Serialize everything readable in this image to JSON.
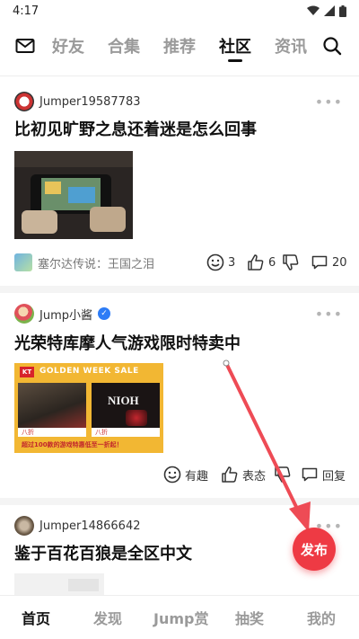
{
  "status_bar": {
    "time": "4:17"
  },
  "top_nav": {
    "tabs": [
      {
        "label": "好友"
      },
      {
        "label": "合集"
      },
      {
        "label": "推荐"
      },
      {
        "label": "社区",
        "active": true
      },
      {
        "label": "资讯"
      }
    ]
  },
  "posts": [
    {
      "author": "Jumper19587783",
      "title": "比初见旷野之息还着迷是怎么回事",
      "tag": "塞尔达传说：王国之泪",
      "stats": {
        "fun": "3",
        "likes": "6",
        "comments": "20"
      }
    },
    {
      "author": "Jump小酱",
      "title": "光荣特库摩人气游戏限时特卖中",
      "banner": {
        "logo": "KT",
        "heading": "GOLDEN WEEK SALE",
        "game_right": "NIOH",
        "footer": "超过100款的游戏特惠低至一折起！",
        "discount_left": "八折",
        "discount_right": "八折"
      },
      "actions": {
        "fun": "有趣",
        "attitude": "表态",
        "reply": "回复"
      }
    },
    {
      "author": "Jumper14866642",
      "title": "鉴于百花百狼是全区中文"
    }
  ],
  "fab": {
    "label": "发布"
  },
  "bottom_nav": {
    "items": [
      {
        "label": "首页",
        "active": true
      },
      {
        "label": "发现"
      },
      {
        "label": "Jump赏"
      },
      {
        "label": "抽奖"
      },
      {
        "label": "我的"
      }
    ]
  },
  "colors": {
    "accent": "#ee3a44",
    "verified": "#2d7cf6",
    "banner_gold": "#f2b733"
  }
}
